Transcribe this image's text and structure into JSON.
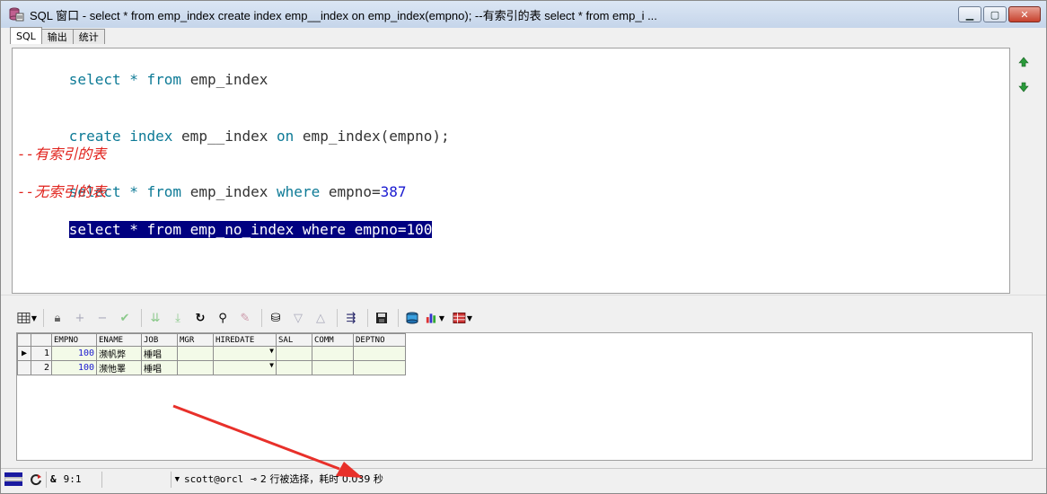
{
  "window": {
    "title": "SQL 窗口 - select * from emp_index create index emp__index on emp_index(empno); --有索引的表 select * from emp_i ...",
    "minimize": "▁",
    "maximize": "▢",
    "close": "✕"
  },
  "tabs": [
    {
      "label": "SQL",
      "active": true
    },
    {
      "label": "输出",
      "active": false
    },
    {
      "label": "统计",
      "active": false
    }
  ],
  "editor": {
    "line1": {
      "kw1": "select",
      "op": "*",
      "kw2": "from",
      "table": "emp_index"
    },
    "line2": {
      "kw1": "create",
      "kw2": "index",
      "name": "emp__index",
      "kw3": "on",
      "target": "emp_index(empno);"
    },
    "comment1": "--有索引的表",
    "line3": {
      "kw1": "select",
      "op": "*",
      "kw2": "from",
      "table": "emp_index",
      "kw3": "where",
      "cond": "empno=",
      "val": "387"
    },
    "comment2": "--无索引的表",
    "line4": {
      "text": "select * from emp_no_index where empno=100"
    }
  },
  "grid": {
    "columns": [
      "EMPNO",
      "ENAME",
      "JOB",
      "MGR",
      "HIREDATE",
      "SAL",
      "COMM",
      "DEPTNO"
    ],
    "rows": [
      {
        "num": "1",
        "empno": "100",
        "ename": "濒帆弊",
        "job": "棰唱",
        "mgr": "",
        "hiredate": "",
        "sal": "",
        "comm": "",
        "deptno": ""
      },
      {
        "num": "2",
        "empno": "100",
        "ename": "濒忚睪",
        "job": "棰唱",
        "mgr": "",
        "hiredate": "",
        "sal": "",
        "comm": "",
        "deptno": ""
      }
    ]
  },
  "statusbar": {
    "amp": "&",
    "position": "9:1",
    "connection": "scott@orcl",
    "message": "2 行被选择，耗时 0.039 秒"
  },
  "colors": {
    "keyword": "#0d7a96",
    "comment": "#e0201a",
    "number": "#1a1ad0",
    "selection": "#000080",
    "annotation_arrow": "#e8302a"
  }
}
